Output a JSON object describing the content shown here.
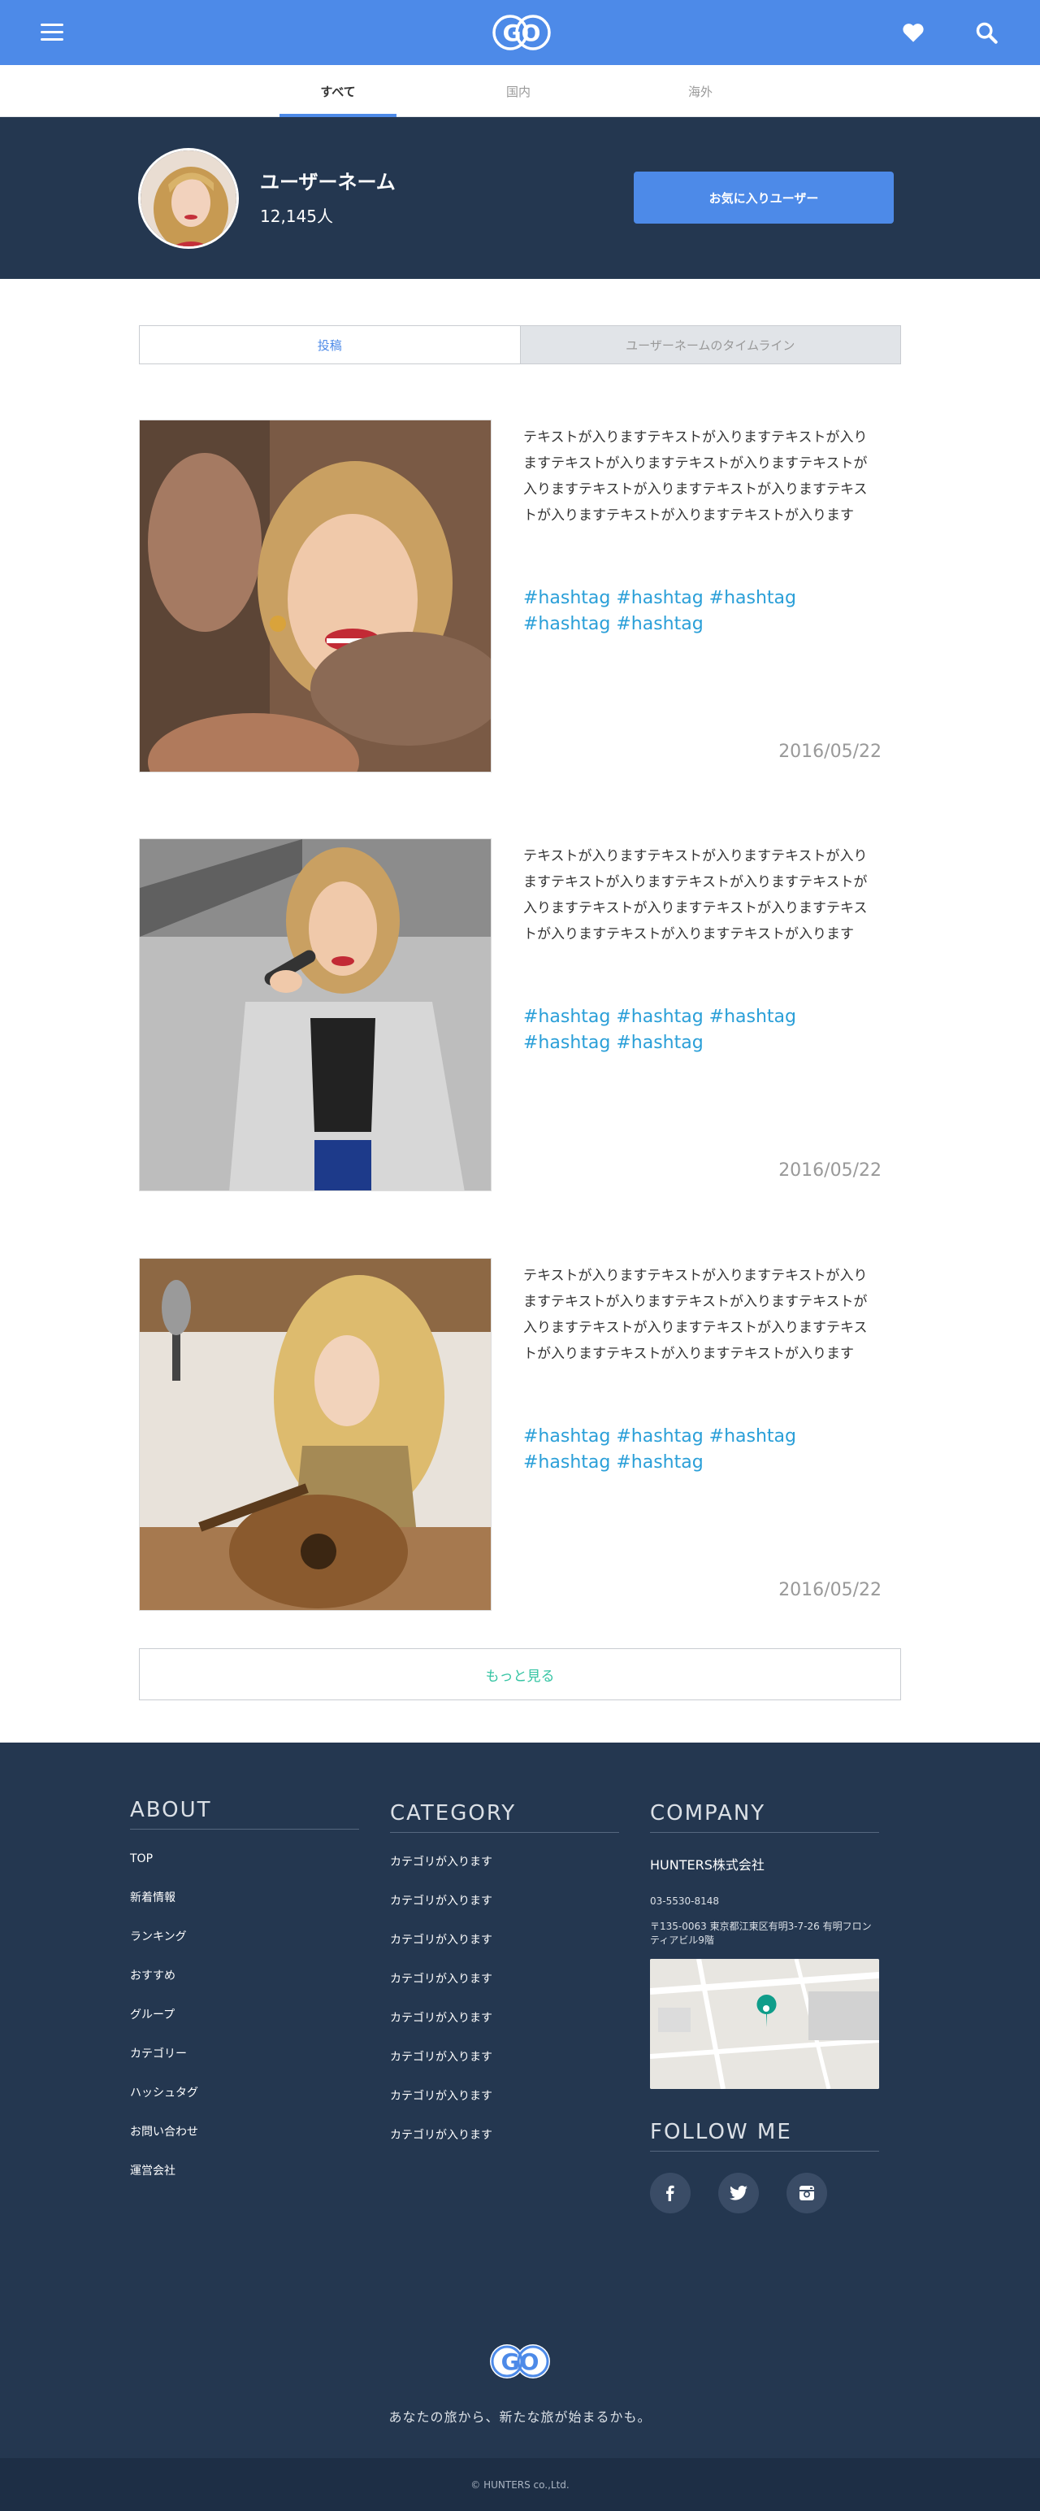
{
  "header": {
    "logo_text": "GO",
    "colors": {
      "brand": "#4d8ae8",
      "navy": "#243750",
      "teal": "#35c4a3",
      "hashtag": "#2a9fd8"
    }
  },
  "region_tabs": [
    {
      "label": "すべて",
      "active": true
    },
    {
      "label": "国内",
      "active": false
    },
    {
      "label": "海外",
      "active": false
    }
  ],
  "profile": {
    "name": "ユーザーネーム",
    "followers": "12,145人",
    "favorite_button": "お気に入りユーザー"
  },
  "content_tabs": {
    "posts": "投稿",
    "timeline": "ユーザーネームのタイムライン"
  },
  "posts": [
    {
      "text": "テキストが入りますテキストが入りますテキストが入りますテキストが入りますテキストが入りますテキストが入りますテキストが入りますテキストが入りますテキストが入りますテキストが入りますテキストが入ります",
      "tags": "#hashtag #hashtag #hashtag #hashtag #hashtag",
      "date": "2016/05/22"
    },
    {
      "text": "テキストが入りますテキストが入りますテキストが入りますテキストが入りますテキストが入りますテキストが入りますテキストが入りますテキストが入りますテキストが入りますテキストが入りますテキストが入ります",
      "tags": "#hashtag #hashtag #hashtag #hashtag #hashtag",
      "date": "2016/05/22"
    },
    {
      "text": "テキストが入りますテキストが入りますテキストが入りますテキストが入りますテキストが入りますテキストが入りますテキストが入りますテキストが入りますテキストが入りますテキストが入りますテキストが入ります",
      "tags": "#hashtag #hashtag #hashtag #hashtag #hashtag",
      "date": "2016/05/22"
    }
  ],
  "more_button": "もっと見る",
  "footer": {
    "about": {
      "title": "ABOUT",
      "links": [
        "TOP",
        "新着情報",
        "ランキング",
        "おすすめ",
        "グループ",
        "カテゴリー",
        "ハッシュタグ",
        "お問い合わせ",
        "運営会社"
      ]
    },
    "category": {
      "title": "CATEGORY",
      "links": [
        "カテゴリが入ります",
        "カテゴリが入ります",
        "カテゴリが入ります",
        "カテゴリが入ります",
        "カテゴリが入ります",
        "カテゴリが入ります",
        "カテゴリが入ります",
        "カテゴリが入ります"
      ]
    },
    "company": {
      "title": "COMPANY",
      "name": "HUNTERS株式会社",
      "phone": "03-5530-8148",
      "address": "〒135-0063 東京都江東区有明3-7-26 有明フロンティアビル9階"
    },
    "follow": {
      "title": "FOLLOW ME",
      "icons": [
        "facebook-icon",
        "twitter-icon",
        "instagram-icon"
      ]
    },
    "logo_text": "GO",
    "tagline": "あなたの旅から、新たな旅が始まるかも。",
    "copyright": "© HUNTERS co.,Ltd."
  }
}
